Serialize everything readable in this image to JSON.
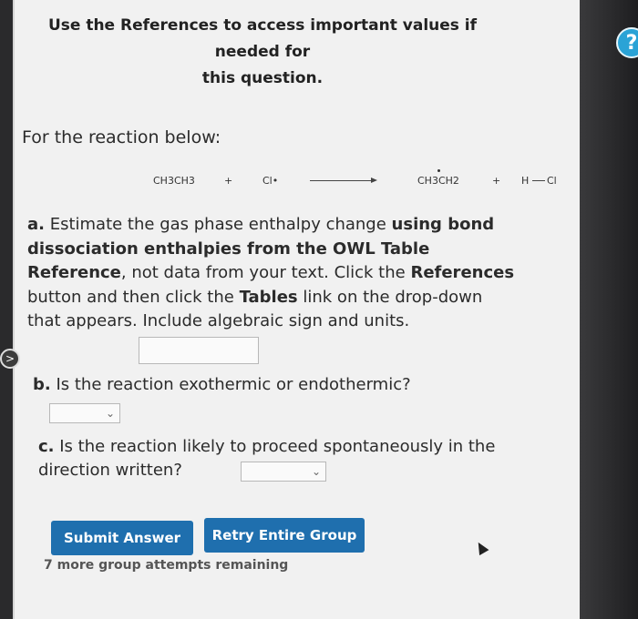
{
  "header": {
    "line1": "Use the References to access important values if needed for",
    "line2": "this question."
  },
  "help_glyph": "?",
  "prompt": "For the reaction below:",
  "reaction": {
    "reactant1": "CH3CH3",
    "plus1": "+",
    "reactant2": "Cl•",
    "product1": "CH3CH2",
    "plus2": "+",
    "product2_left": "H",
    "product2_right": "Cl"
  },
  "question_a": {
    "label": "a.",
    "t1": " Estimate the gas phase enthalpy change ",
    "b1": "using bond dissociation enthalpies from the OWL Table Reference",
    "t2": ", not data from your text. Click the ",
    "b2": "References",
    "t3": " button and then click the ",
    "b3": "Tables",
    "t4": " link on the drop-down that appears. Include algebraic sign and units."
  },
  "question_b": {
    "label": "b.",
    "text": " Is the reaction exothermic or endothermic?"
  },
  "question_c": {
    "label": "c.",
    "text": " Is the reaction likely to proceed spontaneously in the direction written?"
  },
  "side_marker": ">",
  "chevron": "⌄",
  "buttons": {
    "submit": "Submit Answer",
    "retry": "Retry Entire Group"
  },
  "remaining": "7 more group attempts remaining"
}
